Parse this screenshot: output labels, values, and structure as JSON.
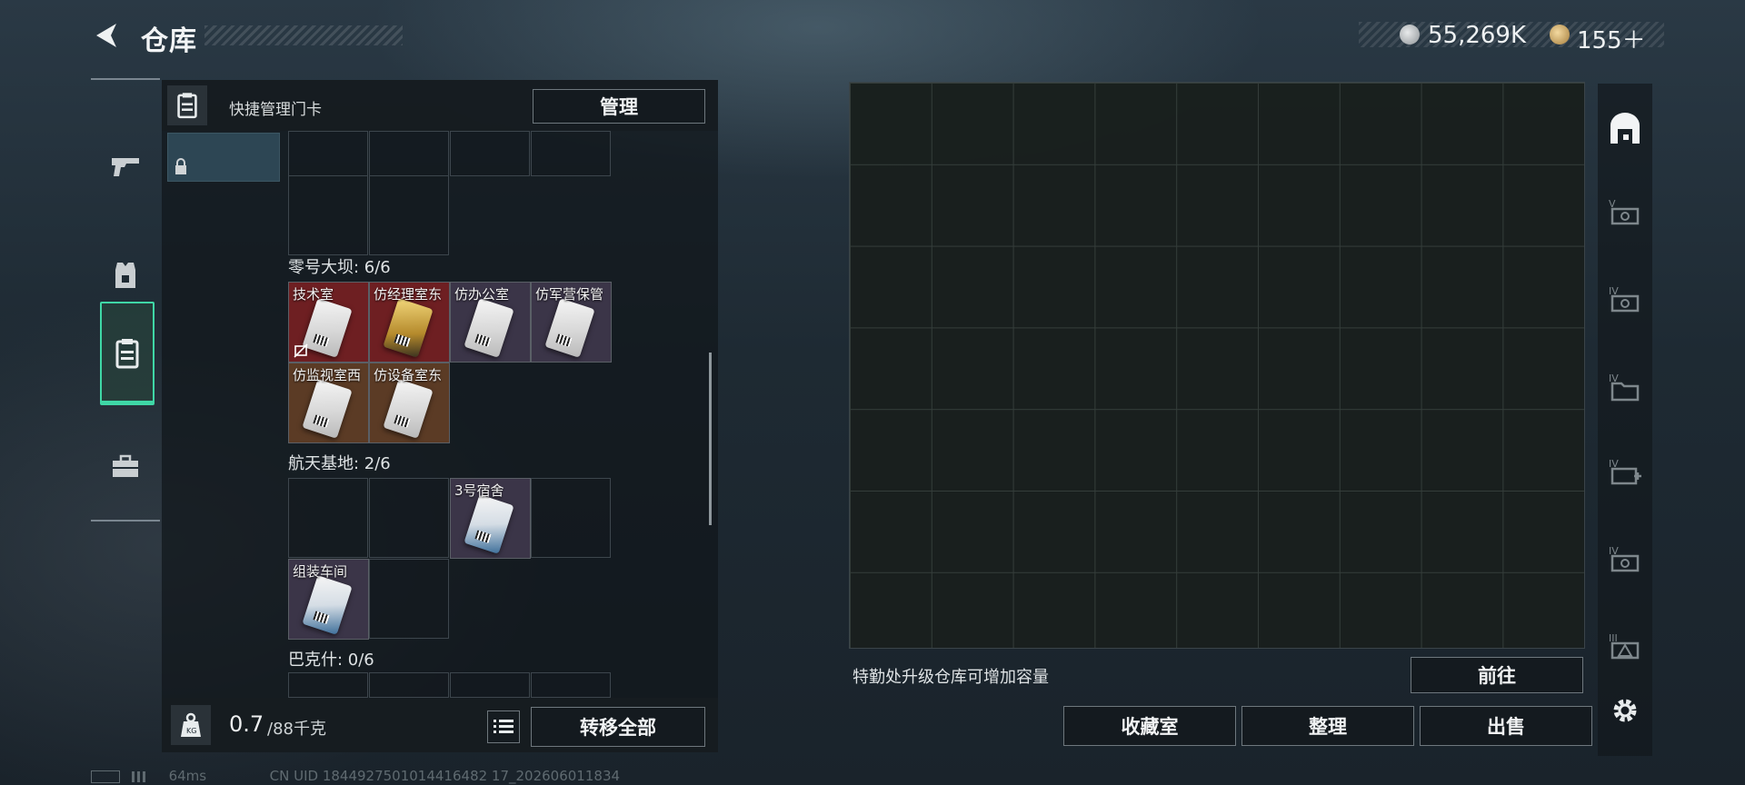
{
  "header": {
    "title": "仓库"
  },
  "currency": [
    {
      "icon": "silver-coin-icon",
      "value": "55,269K",
      "color": "#b8bcbf"
    },
    {
      "icon": "gold-coin-icon",
      "value": "155＋",
      "color": "#c9a465"
    }
  ],
  "left_tabs": [
    {
      "icon": "gun-icon",
      "active": false
    },
    {
      "icon": "armor-vest-icon",
      "active": false
    },
    {
      "icon": "keycard-holder-icon",
      "active": true
    },
    {
      "icon": "toolbox-icon",
      "active": false
    }
  ],
  "keycard_panel": {
    "header_label": "快捷管理门卡",
    "manage_button": "管理",
    "sections": [
      {
        "title": "零号大坝: 6/6",
        "cards": [
          {
            "name": "技术室",
            "bg": "#6e1f22",
            "disabled": true
          },
          {
            "name": "仿经理室东",
            "bg": "#6e1f22",
            "gold": true
          },
          {
            "name": "仿办公室",
            "bg": "#3b3548"
          },
          {
            "name": "仿军营保管",
            "bg": "#3b3548"
          },
          {
            "name": "仿监视室西",
            "bg": "#5b3b25"
          },
          {
            "name": "仿设备室东",
            "bg": "#5b3b25"
          }
        ]
      },
      {
        "title": "航天基地: 2/6",
        "cards": [
          {
            "name": "3号宿舍",
            "bg": "#3b3548"
          },
          {
            "name": "组装车间",
            "bg": "#3b3548"
          }
        ]
      },
      {
        "title": "巴克什: 0/6",
        "cards": []
      }
    ],
    "weight": {
      "current": "0.7",
      "max": "/88千克"
    },
    "transfer_all_button": "转移全部"
  },
  "storage": {
    "hint": "特勤处升级仓库可增加容量",
    "goto_button": "前往",
    "buttons": {
      "collection": "收藏室",
      "sort": "整理",
      "sell": "出售"
    }
  },
  "side_tabs": [
    "home-storage-icon",
    "case-v-icon",
    "case-iv-icon",
    "folder-iv-icon",
    "medkit-iv-icon",
    "case-iv-b-icon",
    "warning-case-iii-icon"
  ],
  "status_bar": {
    "ping": "64ms",
    "uid": "CN UID 1844927501014416482 17_202606011834"
  },
  "colors": {
    "accent": "#3fd7a6"
  }
}
